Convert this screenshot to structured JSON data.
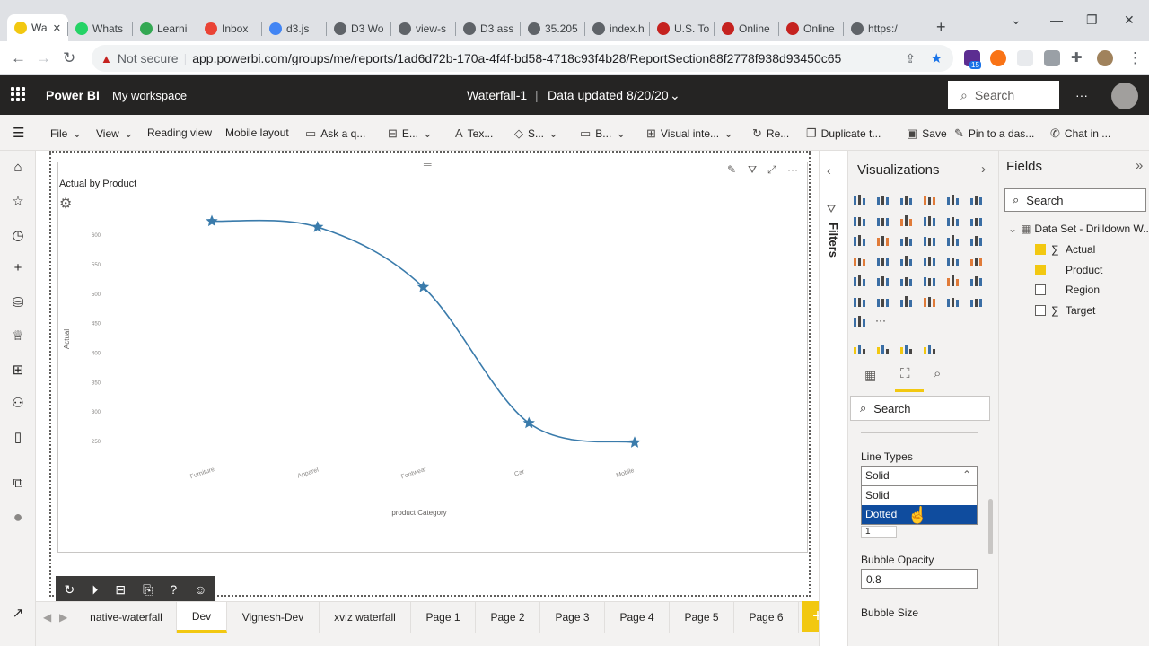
{
  "browser": {
    "tabs": [
      {
        "label": "Wa",
        "color": "#f2c811"
      },
      {
        "label": "Whats",
        "color": "#25d366"
      },
      {
        "label": "Learni",
        "color": "#34a853"
      },
      {
        "label": "Inbox",
        "color": "#ea4335"
      },
      {
        "label": "d3.js",
        "color": "#4285f4"
      },
      {
        "label": "D3 Wo",
        "color": "#5f6368"
      },
      {
        "label": "view-s",
        "color": "#5f6368"
      },
      {
        "label": "D3 ass",
        "color": "#5f6368"
      },
      {
        "label": "35.205",
        "color": "#5f6368"
      },
      {
        "label": "index.h",
        "color": "#5f6368"
      },
      {
        "label": "U.S. To",
        "color": "#c5221f"
      },
      {
        "label": "Online",
        "color": "#c5221f"
      },
      {
        "label": "Online",
        "color": "#c5221f"
      },
      {
        "label": "https:/",
        "color": "#5f6368"
      }
    ],
    "not_secure": "Not secure",
    "url": "app.powerbi.com/groups/me/reports/1ad6d72b-170a-4f4f-bd58-4718c93f4b28/ReportSection88f2778f938d93450c65",
    "ext_badge": "15"
  },
  "header": {
    "app_name": "Power BI",
    "workspace": "My workspace",
    "report_name": "Waterfall-1",
    "updated": "Data updated 8/20/20",
    "search": "Search"
  },
  "ribbon": {
    "file": "File",
    "view": "View",
    "reading_view": "Reading view",
    "mobile_layout": "Mobile layout",
    "ask": "Ask a q...",
    "explore": "E...",
    "textbox": "Tex...",
    "shapes": "S...",
    "buttons": "B...",
    "visual_interactions": "Visual inte...",
    "refresh": "Re...",
    "duplicate": "Duplicate t...",
    "save": "Save",
    "pin": "Pin to a das...",
    "chat": "Chat in ..."
  },
  "visual": {
    "title": "Actual by Product"
  },
  "chart_data": {
    "type": "line",
    "title": "Actual by Product",
    "xlabel": "product Category",
    "ylabel": "Actual",
    "categories": [
      "Furniture",
      "Apparel",
      "Footwear",
      "Car",
      "Mobile"
    ],
    "values": [
      624,
      614,
      512,
      281,
      248
    ],
    "y_ticks": [
      250,
      300,
      350,
      400,
      450,
      500,
      550,
      600
    ],
    "ylim": [
      230,
      640
    ],
    "line_color": "#3a7bab",
    "marker": "star",
    "curve": "smooth"
  },
  "pages": [
    "native-waterfall",
    "Dev",
    "Vignesh-Dev",
    "xviz waterfall",
    "Page 1",
    "Page 2",
    "Page 3",
    "Page 4",
    "Page 5",
    "Page 6"
  ],
  "selected_page": "Dev",
  "filters_label": "Filters",
  "viz_pane": {
    "title": "Visualizations",
    "search": "Search",
    "line_types_label": "Line Types",
    "line_types_value": "Solid",
    "line_types_options": [
      "Solid",
      "Dotted"
    ],
    "bubble_opacity_label": "Bubble Opacity",
    "bubble_opacity_value": "0.8",
    "bubble_size_label": "Bubble Size",
    "stepper_value": "1"
  },
  "fields_pane": {
    "title": "Fields",
    "search": "Search",
    "table": "Data Set - Drilldown W...",
    "fields": [
      {
        "name": "Actual",
        "sigma": true,
        "checked": true
      },
      {
        "name": "Product",
        "sigma": false,
        "checked": true
      },
      {
        "name": "Region",
        "sigma": false,
        "checked": false
      },
      {
        "name": "Target",
        "sigma": true,
        "checked": false
      }
    ]
  },
  "colors": {
    "brand": "#f2c811",
    "header_bg": "#252423",
    "selection": "#0f4c9e"
  }
}
